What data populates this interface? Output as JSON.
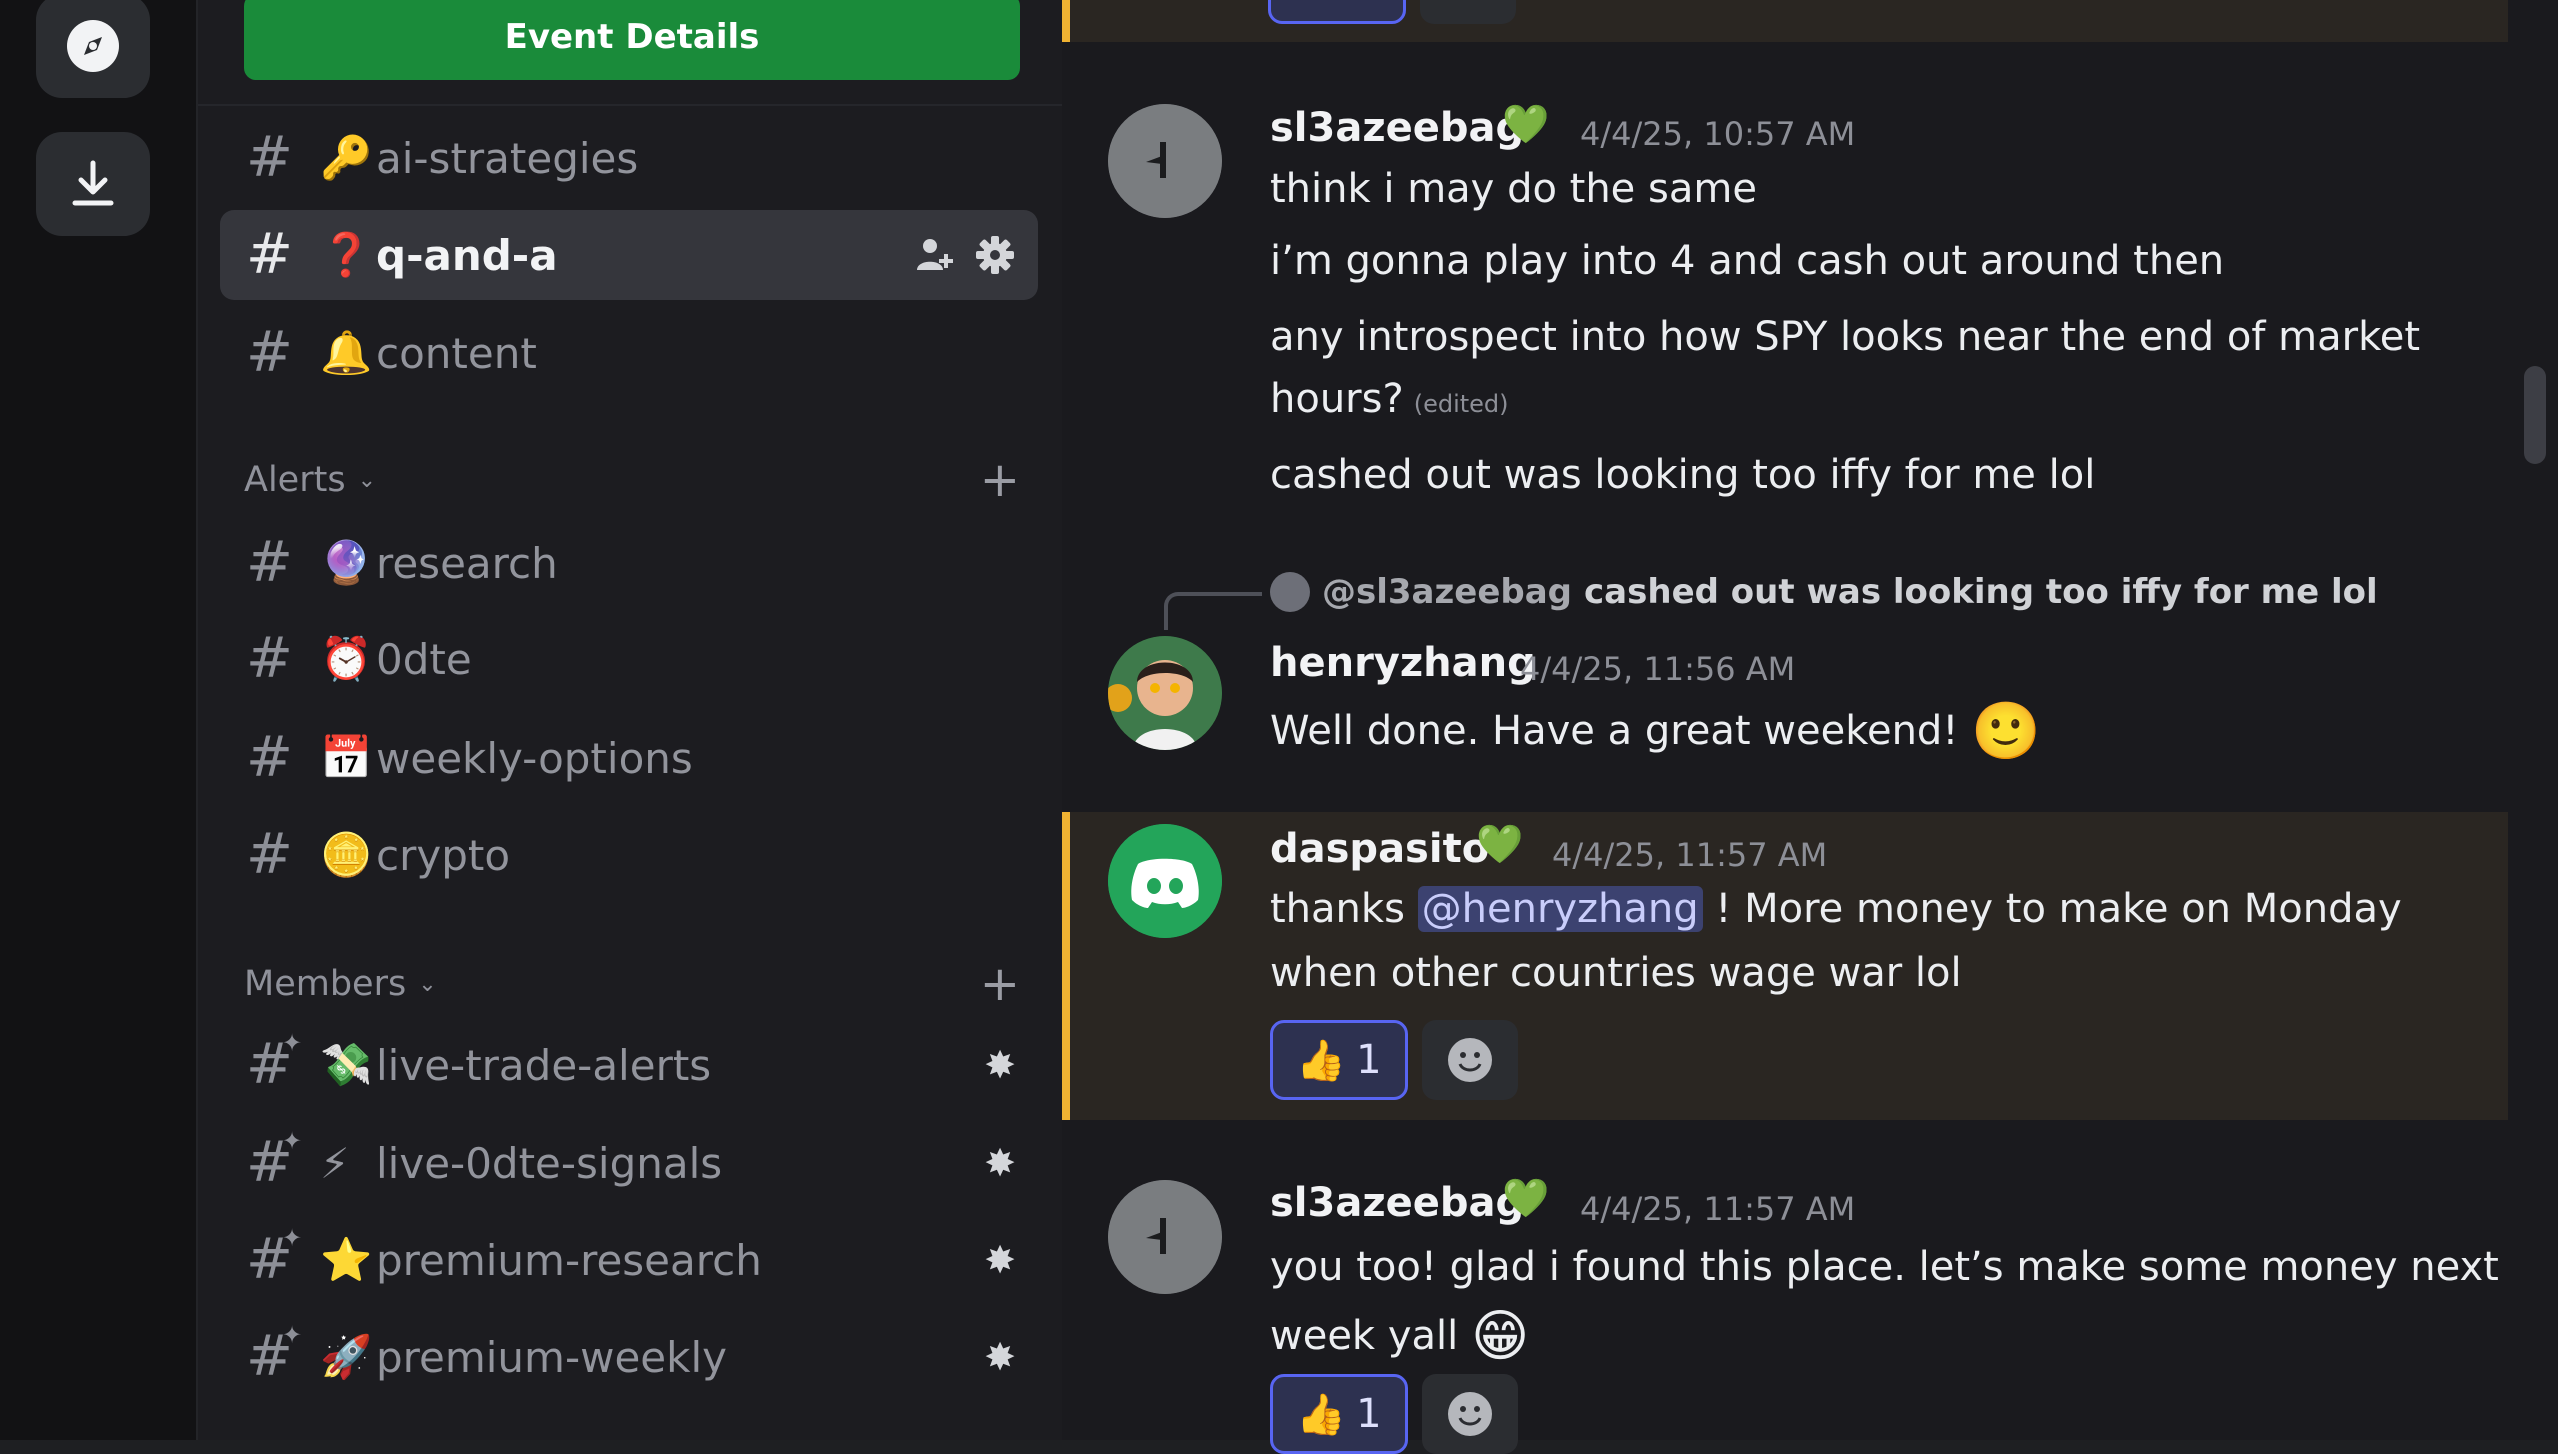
{
  "sidebar": {
    "event_button": "Event Details",
    "channels_top": [
      {
        "name": "ai-strategies",
        "emoji": "🔑"
      },
      {
        "name": "q-and-a",
        "emoji": "❓",
        "active": true
      },
      {
        "name": "content",
        "emoji": "🔔"
      }
    ],
    "category_alerts": "Alerts",
    "channels_alerts": [
      {
        "name": "research",
        "emoji": "🔮"
      },
      {
        "name": "0dte",
        "emoji": "⏰"
      },
      {
        "name": "weekly-options",
        "emoji": "📅"
      },
      {
        "name": "crypto",
        "emoji": "🪙"
      }
    ],
    "category_members": "Members",
    "channels_members": [
      {
        "name": "live-trade-alerts",
        "emoji": "💸"
      },
      {
        "name": "live-0dte-signals",
        "emoji": "⚡"
      },
      {
        "name": "premium-research",
        "emoji": "⭐"
      },
      {
        "name": "premium-weekly",
        "emoji": "🚀"
      }
    ]
  },
  "messages": {
    "m1": {
      "user": "sl3azeebag",
      "time": "4/4/25, 10:57 AM",
      "lines": [
        "think i may do the same",
        "i’m gonna play into 4 and cash out around then",
        "any introspect into how SPY looks near the end of market",
        "hours?",
        "cashed out was looking too iffy for me lol"
      ],
      "edited": "(edited)"
    },
    "m2": {
      "reply_to": "@sl3azeebag",
      "reply_text": "cashed out was looking too iffy for me lol",
      "user": "henryzhang",
      "time": "4/4/25, 11:56 AM",
      "text": "Well done. Have a great weekend!",
      "emoji": "🙂"
    },
    "m3": {
      "user": "daspasito",
      "time": "4/4/25, 11:57 AM",
      "pre": "thanks",
      "mention": "@henryzhang",
      "post": "! More money to make on Monday",
      "line2": "when other countries wage war lol",
      "reaction_emoji": "👍",
      "reaction_count": "1"
    },
    "m4": {
      "user": "sl3azeebag",
      "time": "4/4/25, 11:57 AM",
      "line1": "you too! glad i found this place. let’s make some money next",
      "line2": "week yall",
      "emoji": "😁",
      "reaction_emoji": "👍",
      "reaction_count": "1"
    }
  },
  "colors": {
    "accent": "#5865f2",
    "highlight_bar": "#f0b232",
    "event_green": "#1a8b3a"
  }
}
